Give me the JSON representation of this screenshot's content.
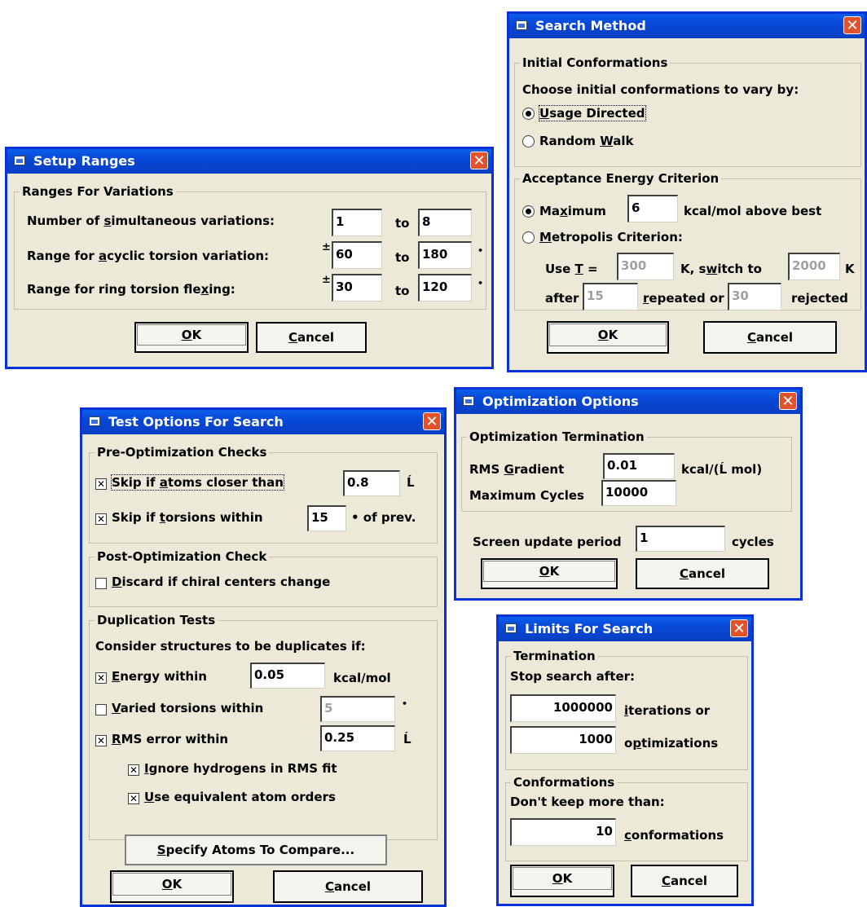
{
  "setup_ranges": {
    "title": "Setup Ranges",
    "group": "Ranges For Variations",
    "row1_label_a": "Number of ",
    "row1_label_u": "s",
    "row1_label_b": "imultaneous variations:",
    "row1_from": "1",
    "row1_to_label": "to",
    "row1_to": "8",
    "row2_label_a": "Range for ",
    "row2_label_u": "a",
    "row2_label_b": "cyclic torsion variation:",
    "row2_pm": "±",
    "row2_from": "60",
    "row2_to_label": "to",
    "row2_to": "180",
    "row2_unit": "•",
    "row3_label_a": "Range for ring torsion fle",
    "row3_label_u": "x",
    "row3_label_b": "ing:",
    "row3_pm": "±",
    "row3_from": "30",
    "row3_to_label": "to",
    "row3_to": "120",
    "row3_unit": "•",
    "ok_u": "O",
    "ok_rest": "K",
    "cancel_u": "C",
    "cancel_rest": "ancel"
  },
  "search_method": {
    "title": "Search Method",
    "group1": "Initial Conformations",
    "prompt": "Choose initial conformations to vary by:",
    "opt1_u": "U",
    "opt1_rest": "sage Directed",
    "opt2_a": "Random ",
    "opt2_u": "W",
    "opt2_b": "alk",
    "group2": "Acceptance Energy Criterion",
    "max_a": "Ma",
    "max_u": "x",
    "max_b": "imum",
    "max_value": "6",
    "max_unit": "kcal/mol above best",
    "metro_u": "M",
    "metro_rest": "etropolis Criterion:",
    "use_a": "Use ",
    "use_u": "T",
    "use_b": " =",
    "use_temp": "300",
    "switch_a": "K, s",
    "switch_u": "w",
    "switch_b": "itch to",
    "switch_temp": "2000",
    "switch_unit": "K",
    "after": "after",
    "after_val": "15",
    "rep_u": "r",
    "rep_rest": "epeated or",
    "rej_val": "30",
    "rej_a": "re",
    "rej_u": "j",
    "rej_b": "ected",
    "ok_u": "O",
    "ok_rest": "K",
    "cancel_u": "C",
    "cancel_rest": "ancel"
  },
  "test_options": {
    "title": "Test Options For Search",
    "group1": "Pre-Optimization Checks",
    "chk1_a": "Skip if ",
    "chk1_u": "a",
    "chk1_b": "toms closer than",
    "chk1_val": "0.8",
    "chk1_unit": "Ĺ",
    "chk2_a": "Skip if ",
    "chk2_u": "t",
    "chk2_b": "orsions within",
    "chk2_val": "15",
    "chk2_unit": "• of prev.",
    "group2": "Post-Optimization Check",
    "chk3_u": "D",
    "chk3_rest": "iscard if chiral centers change",
    "group3": "Duplication Tests",
    "dup_prompt": "Consider structures to be duplicates if:",
    "chk4_u": "E",
    "chk4_rest": "nergy within",
    "chk4_val": "0.05",
    "chk4_unit": "kcal/mol",
    "chk5_u": "V",
    "chk5_rest": "aried torsions within",
    "chk5_val": "5",
    "chk5_unit": "•",
    "chk6_u": "R",
    "chk6_rest": "MS error within",
    "chk6_val": "0.25",
    "chk6_unit": "Ĺ",
    "chk7_u": "I",
    "chk7_rest": "gnore hydrogens in RMS fit",
    "chk8_u": "U",
    "chk8_rest": "se equivalent atom orders",
    "specify_u": "S",
    "specify_rest": "pecify Atoms To Compare...",
    "ok_u": "O",
    "ok_rest": "K",
    "cancel_u": "C",
    "cancel_rest": "ancel"
  },
  "optimization": {
    "title": "Optimization Options",
    "group": "Optimization Termination",
    "rms_a": "RMS ",
    "rms_u": "G",
    "rms_b": "radient",
    "rms_val": "0.01",
    "rms_unit": "kcal/(Ĺ mol)",
    "cycles_label": "Maximum Cycles",
    "cycles_val": "10000",
    "screen_label": "Screen update period",
    "screen_val": "1",
    "screen_unit": "cycles",
    "ok_u": "O",
    "ok_rest": "K",
    "cancel_u": "C",
    "cancel_rest": "ancel"
  },
  "limits": {
    "title": "Limits For Search",
    "group1": "Termination",
    "stop": "Stop search after:",
    "iter_val": "1000000",
    "iter_u": "i",
    "iter_rest": "terations or",
    "opt_val": "1000",
    "opt_a": "o",
    "opt_u": "p",
    "opt_b": "timizations",
    "group2": "Conformations",
    "keep": "Don't keep more than:",
    "conf_val": "10",
    "conf_u": "c",
    "conf_rest": "onformations",
    "ok_u": "O",
    "ok_rest": "K",
    "cancel_u": "C",
    "cancel_rest": "ancel"
  },
  "icons": {
    "close": "✕",
    "check": "✕"
  },
  "colors": {
    "titlebar": "#0848d8",
    "close": "#e2532c",
    "dialog": "#ece9d8"
  }
}
